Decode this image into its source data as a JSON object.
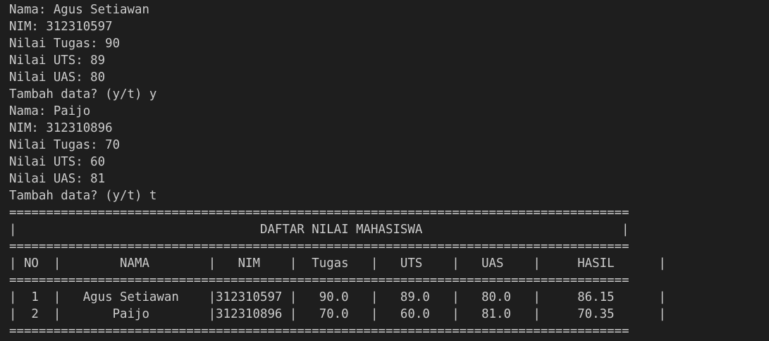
{
  "terminal": {
    "prompt_lines": [
      "Nama: Agus Setiawan",
      "NIM: 312310597",
      "Nilai Tugas: 90",
      "Nilai UTS: 89",
      "Nilai UAS: 80",
      "Tambah data? (y/t) y",
      "Nama: Paijo",
      "NIM: 312310896",
      "Nilai Tugas: 70",
      "Nilai UTS: 60",
      "Nilai UAS: 81",
      "Tambah data? (y/t) t"
    ],
    "table": {
      "border_top": "====================================================================================",
      "title_row": "|                                 DAFTAR NILAI MAHASISWA                           |",
      "border_after_title": "====================================================================================",
      "header_row": "| NO  |        NAMA        |   NIM    |  Tugas   |   UTS    |   UAS    |     HASIL      |",
      "border_after_header": "====================================================================================",
      "rows": [
        "|  1  |   Agus Setiawan    |312310597 |   90.0   |   89.0   |   80.0   |     86.15      |",
        "|  2  |       Paijo        |312310896 |   70.0   |   60.0   |   81.0   |     70.35      |"
      ],
      "border_bottom": "===================================================================================="
    }
  }
}
